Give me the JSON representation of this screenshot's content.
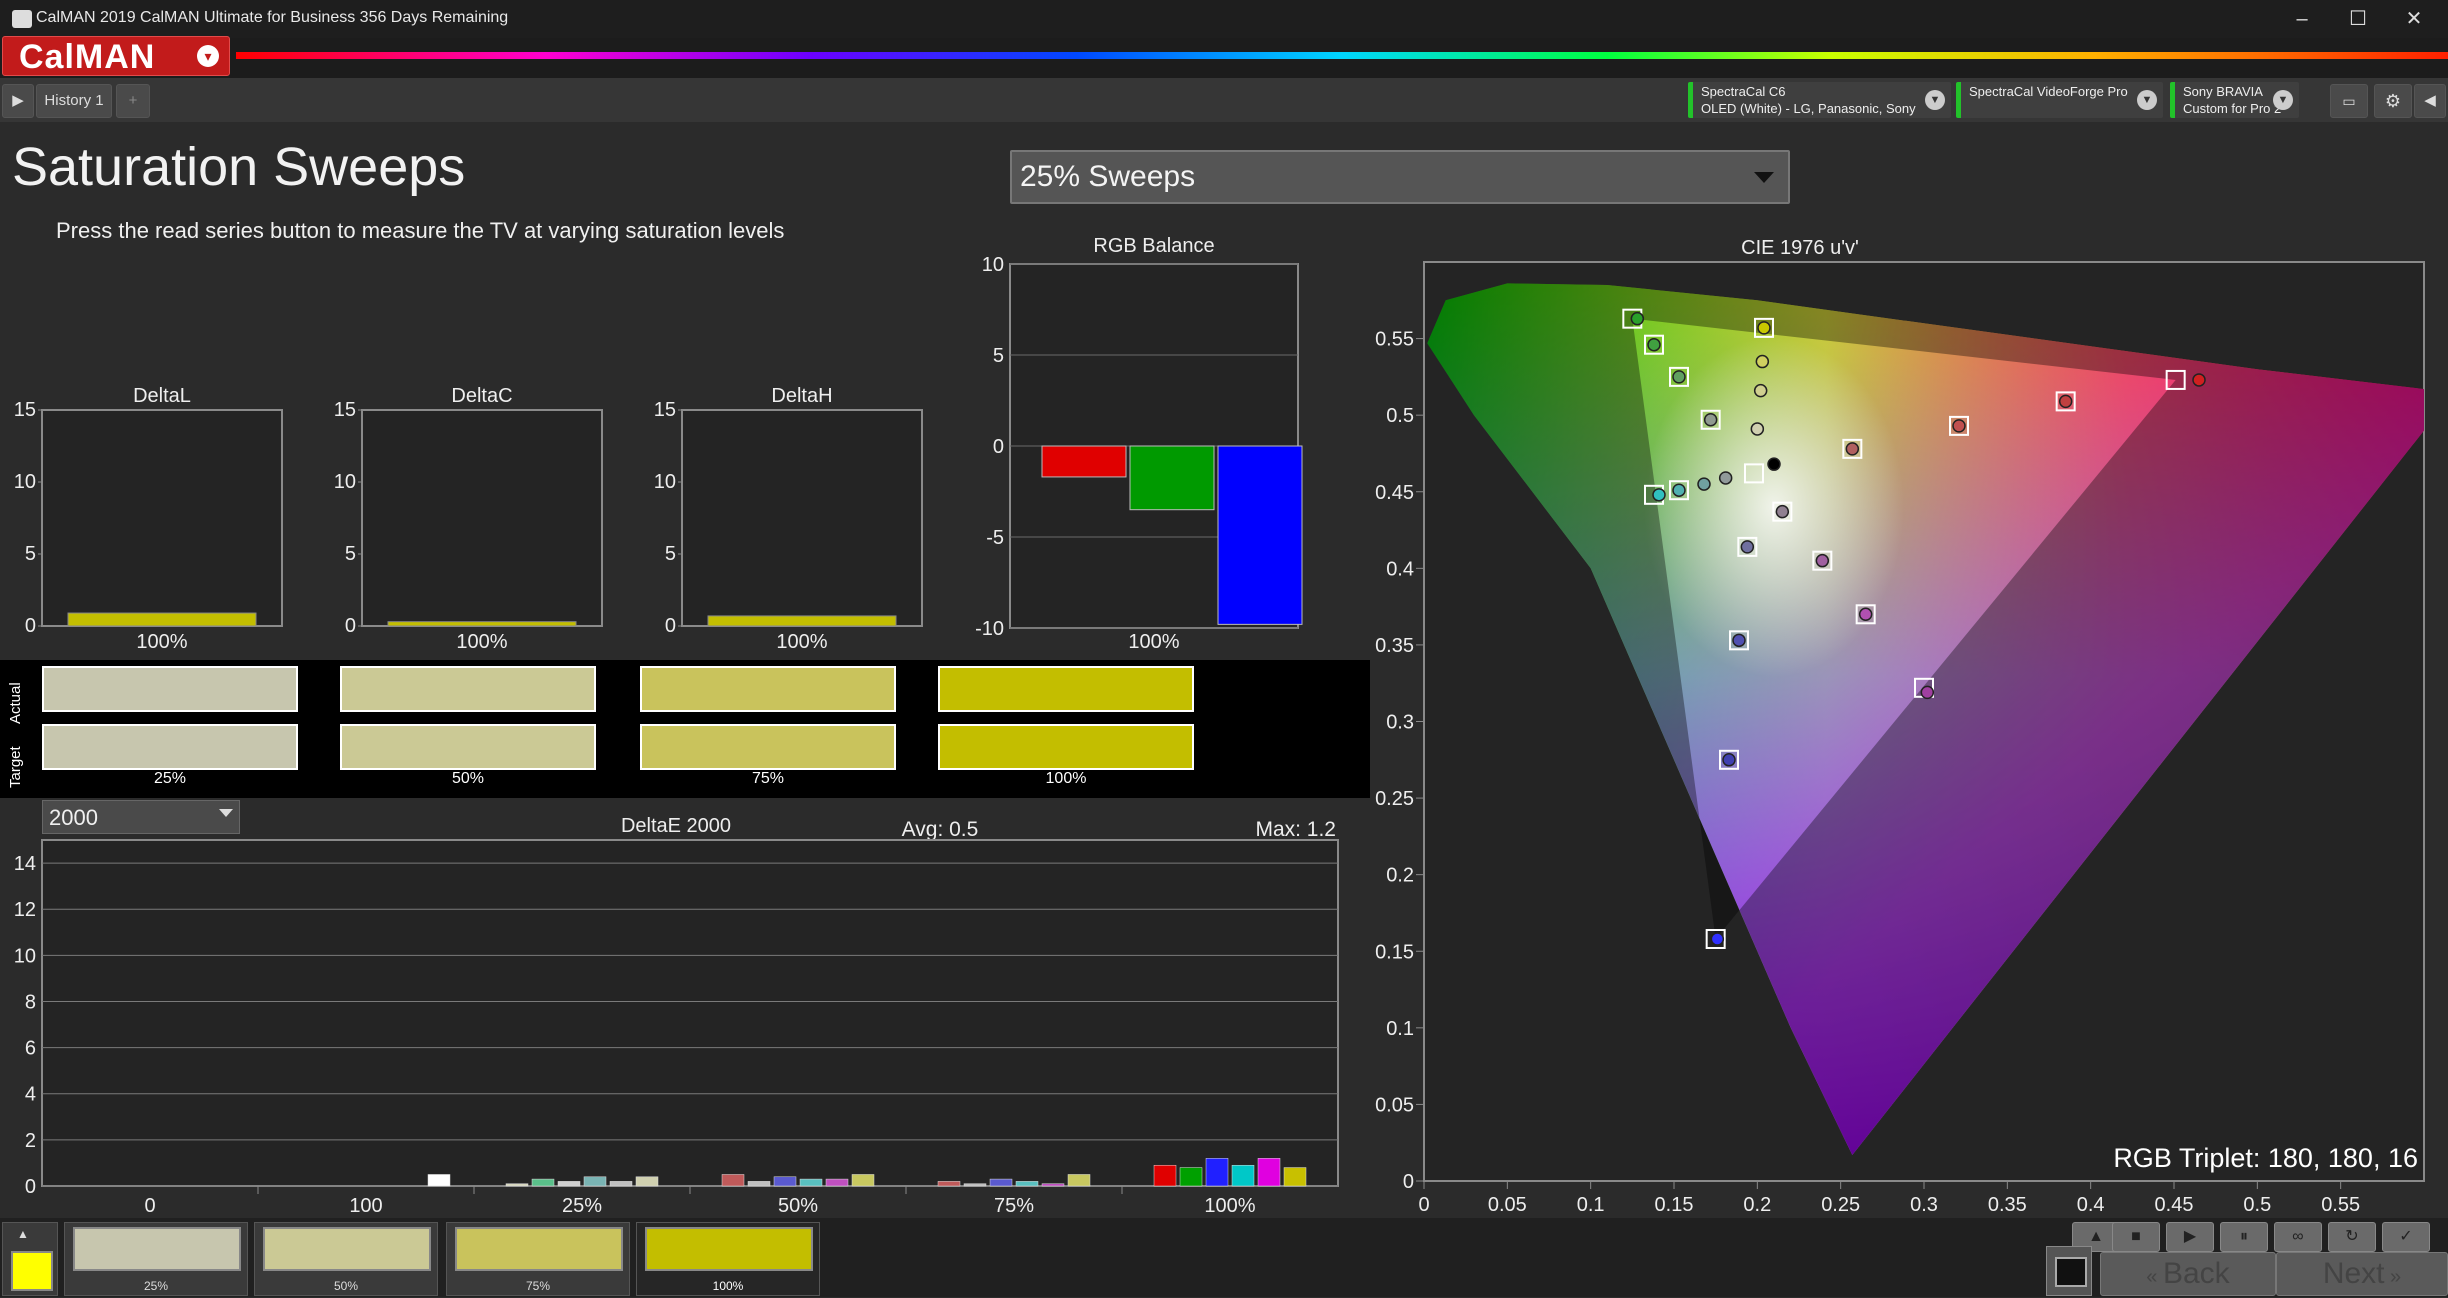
{
  "window": {
    "title": "CalMAN 2019 CalMAN Ultimate for Business 356 Days Remaining",
    "controls": {
      "minimize": "–",
      "maximize": "☐",
      "close": "✕"
    }
  },
  "brand": {
    "name": "CalMAN",
    "dropdown_icon": "▾"
  },
  "tabs": {
    "history": "History 1",
    "add": "+"
  },
  "devices": [
    {
      "line1": "SpectraCal C6",
      "line2": "OLED (White) - LG, Panasonic, Sony"
    },
    {
      "line1": "SpectraCal VideoForge Pro",
      "line2": ""
    },
    {
      "line1": "Sony BRAVIA",
      "line2": "Custom for Pro 2"
    }
  ],
  "page": {
    "title": "Saturation Sweeps",
    "subtitle": "Press the read series button to measure the TV at varying saturation levels",
    "sweep_select": "25% Sweeps"
  },
  "colors": {
    "accent_red": "#c21b1b",
    "device_ok": "#22c22a",
    "yellow_sample": "#c8c000"
  },
  "delta_charts": {
    "y_ticks": [
      "15",
      "10",
      "5",
      "0"
    ],
    "x_label": "100%",
    "charts": [
      {
        "title": "DeltaL",
        "value": 0.9
      },
      {
        "title": "DeltaC",
        "value": 0.3
      },
      {
        "title": "DeltaH",
        "value": 0.7
      }
    ]
  },
  "rgb_balance": {
    "title": "RGB Balance",
    "y_ticks": [
      "10",
      "5",
      "0",
      "-5",
      "-10"
    ],
    "x_label": "100%",
    "values": {
      "red": -1.7,
      "green": -3.5,
      "blue": -9.8
    }
  },
  "swatches": {
    "row_labels": {
      "actual": "Actual",
      "target": "Target"
    },
    "items": [
      {
        "label": "25%",
        "actual": "#c7c6ae",
        "target": "#c7c6ae"
      },
      {
        "label": "50%",
        "actual": "#cbc995",
        "target": "#cbc995"
      },
      {
        "label": "75%",
        "actual": "#c9c35c",
        "target": "#c9c35c"
      },
      {
        "label": "100%",
        "actual": "#c3be00",
        "target": "#c3be00"
      }
    ]
  },
  "deltae": {
    "selector": "2000",
    "title": "DeltaE 2000",
    "avg": "Avg: 0.5",
    "max": "Max: 1.2",
    "y_ticks": [
      "14",
      "12",
      "10",
      "8",
      "6",
      "4",
      "2",
      "0"
    ],
    "groups": [
      "0",
      "100",
      "25%",
      "50%",
      "75%",
      "100%"
    ]
  },
  "cie": {
    "title": "CIE 1976 u'v'",
    "x_ticks": [
      "0",
      "0.05",
      "0.1",
      "0.15",
      "0.2",
      "0.25",
      "0.3",
      "0.35",
      "0.4",
      "0.45",
      "0.5",
      "0.55"
    ],
    "y_ticks": [
      "0.55",
      "0.5",
      "0.45",
      "0.4",
      "0.35",
      "0.3",
      "0.25",
      "0.2",
      "0.15",
      "0.1",
      "0.05",
      "0"
    ],
    "triplet": "RGB Triplet: 180, 180, 16",
    "gamut": {
      "red": [
        0.451,
        0.523
      ],
      "green": [
        0.125,
        0.563
      ],
      "blue": [
        0.175,
        0.158
      ]
    },
    "whitepoint": [
      0.198,
      0.468
    ]
  },
  "chart_data": [
    {
      "type": "bar",
      "title": "DeltaL",
      "categories": [
        "100%"
      ],
      "values": [
        0.9
      ],
      "ylim": [
        0,
        15
      ]
    },
    {
      "type": "bar",
      "title": "DeltaC",
      "categories": [
        "100%"
      ],
      "values": [
        0.3
      ],
      "ylim": [
        0,
        15
      ]
    },
    {
      "type": "bar",
      "title": "DeltaH",
      "categories": [
        "100%"
      ],
      "values": [
        0.7
      ],
      "ylim": [
        0,
        15
      ]
    },
    {
      "type": "bar",
      "title": "RGB Balance",
      "categories": [
        "100%"
      ],
      "series": [
        {
          "name": "",
          "color": "#e00000",
          "values": [
            -1.7
          ]
        },
        {
          "name": "",
          "color": "#009a00",
          "values": [
            -3.5
          ]
        },
        {
          "name": "",
          "color": "#0000ff",
          "values": [
            -9.8
          ]
        }
      ],
      "ylim": [
        -10,
        10
      ]
    },
    {
      "type": "bar",
      "title": "DeltaE 2000",
      "categories": [
        "0",
        "100",
        "25%",
        "50%",
        "75%",
        "100%"
      ],
      "bar_colors": [
        "#c8c8c8",
        "#d4d4d4",
        "#e6e6e6",
        "#d8d8d8",
        "#c05a5a",
        "#c0c0c0",
        "#c8c8c8",
        "#5a5ad0",
        "#59c0c0",
        "#c050c0",
        "#c8c860"
      ],
      "bars": [
        {
          "group": "0",
          "values": [
            0.0
          ]
        },
        {
          "group": "100",
          "values": [
            0.0,
            0.5
          ]
        },
        {
          "group": "25%",
          "values": [
            0.1,
            0.3,
            0.2,
            0.4,
            0.2,
            0.4
          ]
        },
        {
          "group": "50%",
          "values": [
            0.5,
            0.2,
            0.4,
            0.3,
            0.3,
            0.5
          ]
        },
        {
          "group": "75%",
          "values": [
            0.2,
            0.1,
            0.3,
            0.2,
            0.1,
            0.5
          ]
        },
        {
          "group": "100%",
          "values": [
            0.9,
            0.8,
            1.2,
            0.9,
            1.2,
            0.8
          ]
        }
      ],
      "series_colors": [
        [
          "#d0d0d0"
        ],
        [
          "#cfcfcf",
          "#ffffff"
        ],
        [
          "#d8d8c0",
          "#5ac08a",
          "#d0d0d0",
          "#7ab4b4",
          "#c0c0c0",
          "#d0d0b0"
        ],
        [
          "#c05a5a",
          "#c0c0c0",
          "#5a5ad0",
          "#59c0c0",
          "#c050c0",
          "#c8c860"
        ],
        [
          "#c05a5a",
          "#c0c0c0",
          "#5a5ad0",
          "#59c0c0",
          "#c050c0",
          "#c8c860"
        ],
        [
          "#e00000",
          "#00a000",
          "#2020ff",
          "#00c8c8",
          "#e000e0",
          "#c8c000"
        ]
      ],
      "ylim": [
        0,
        15
      ],
      "avg": 0.5,
      "max": 1.2
    },
    {
      "type": "scatter",
      "title": "CIE 1976 u'v'",
      "xlim": [
        0,
        0.6
      ],
      "ylim": [
        0,
        0.6
      ],
      "targets": [
        {
          "u": 0.125,
          "v": 0.563,
          "color": "#00c000"
        },
        {
          "u": 0.451,
          "v": 0.523,
          "color": "#ff0000"
        },
        {
          "u": 0.175,
          "v": 0.158,
          "color": "#3030ff"
        },
        {
          "u": 0.198,
          "v": 0.462,
          "color": "#ffffff"
        },
        {
          "u": 0.3,
          "v": 0.322,
          "color": "#ff40ff"
        },
        {
          "u": 0.204,
          "v": 0.557,
          "color": "#f0f000"
        },
        {
          "u": 0.138,
          "v": 0.546,
          "color": "#60d060"
        },
        {
          "u": 0.153,
          "v": 0.525,
          "color": "#80d080"
        },
        {
          "u": 0.172,
          "v": 0.497,
          "color": "#a0c0a0"
        },
        {
          "u": 0.138,
          "v": 0.448,
          "color": "#30e0e0"
        },
        {
          "u": 0.153,
          "v": 0.451,
          "color": "#60d0d0"
        },
        {
          "u": 0.385,
          "v": 0.509,
          "color": "#ff5050"
        },
        {
          "u": 0.321,
          "v": 0.493,
          "color": "#ff7070"
        },
        {
          "u": 0.257,
          "v": 0.478,
          "color": "#ff9090"
        },
        {
          "u": 0.265,
          "v": 0.37,
          "color": "#ff80ff"
        },
        {
          "u": 0.239,
          "v": 0.405,
          "color": "#e090e0"
        },
        {
          "u": 0.215,
          "v": 0.437,
          "color": "#d0a0d0"
        },
        {
          "u": 0.189,
          "v": 0.353,
          "color": "#7070ff"
        },
        {
          "u": 0.183,
          "v": 0.275,
          "color": "#5050ff"
        },
        {
          "u": 0.194,
          "v": 0.414,
          "color": "#a0a0ff"
        }
      ],
      "measured": [
        {
          "u": 0.128,
          "v": 0.563,
          "color": "#2aa02a"
        },
        {
          "u": 0.465,
          "v": 0.523,
          "color": "#d02020"
        },
        {
          "u": 0.176,
          "v": 0.158,
          "color": "#3030ff"
        },
        {
          "u": 0.21,
          "v": 0.468,
          "color": "#000000"
        },
        {
          "u": 0.302,
          "v": 0.319,
          "color": "#a040a0"
        },
        {
          "u": 0.204,
          "v": 0.557,
          "color": "#c8c800"
        },
        {
          "u": 0.203,
          "v": 0.535,
          "color": "#d0d060"
        },
        {
          "u": 0.202,
          "v": 0.516,
          "color": "#d0d090"
        },
        {
          "u": 0.2,
          "v": 0.491,
          "color": "#d0d0b0"
        },
        {
          "u": 0.138,
          "v": 0.546,
          "color": "#40a040"
        },
        {
          "u": 0.153,
          "v": 0.525,
          "color": "#60a060"
        },
        {
          "u": 0.172,
          "v": 0.497,
          "color": "#909a90"
        },
        {
          "u": 0.141,
          "v": 0.448,
          "color": "#30c0c0"
        },
        {
          "u": 0.153,
          "v": 0.451,
          "color": "#50b0b0"
        },
        {
          "u": 0.168,
          "v": 0.455,
          "color": "#70a0a0"
        },
        {
          "u": 0.181,
          "v": 0.459,
          "color": "#909a9a"
        },
        {
          "u": 0.385,
          "v": 0.509,
          "color": "#c04040"
        },
        {
          "u": 0.321,
          "v": 0.493,
          "color": "#c05050"
        },
        {
          "u": 0.257,
          "v": 0.478,
          "color": "#b06060"
        },
        {
          "u": 0.265,
          "v": 0.37,
          "color": "#b050b0"
        },
        {
          "u": 0.239,
          "v": 0.405,
          "color": "#a060a0"
        },
        {
          "u": 0.215,
          "v": 0.437,
          "color": "#908090"
        },
        {
          "u": 0.189,
          "v": 0.353,
          "color": "#5050b0"
        },
        {
          "u": 0.183,
          "v": 0.275,
          "color": "#4040b0"
        },
        {
          "u": 0.194,
          "v": 0.414,
          "color": "#7070a0"
        }
      ]
    }
  ],
  "bottom": {
    "thumbs": [
      {
        "label": "25%",
        "color": "#c7c6ae"
      },
      {
        "label": "50%",
        "color": "#cbc995"
      },
      {
        "label": "75%",
        "color": "#c9c35c"
      },
      {
        "label": "100%",
        "color": "#c3be00"
      }
    ],
    "back": "Back",
    "next": "Next",
    "current_color": "#ffff00"
  }
}
